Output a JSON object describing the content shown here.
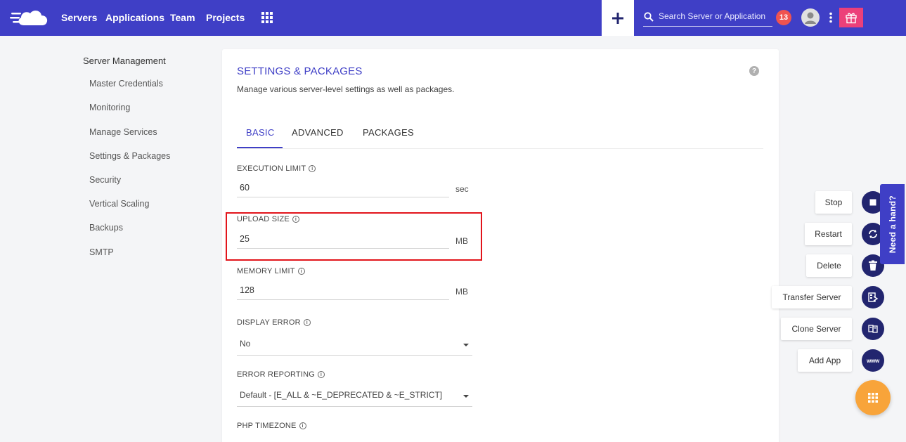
{
  "header": {
    "nav": [
      "Servers",
      "Applications",
      "Team",
      "Projects"
    ],
    "search_placeholder": "Search Server or Application",
    "notification_count": "13",
    "accent_color": "#3f3fc6"
  },
  "sidebar": {
    "title": "Server Management",
    "items": [
      "Master Credentials",
      "Monitoring",
      "Manage Services",
      "Settings & Packages",
      "Security",
      "Vertical Scaling",
      "Backups",
      "SMTP"
    ]
  },
  "card": {
    "title": "SETTINGS & PACKAGES",
    "subtitle": "Manage various server-level settings as well as packages.",
    "help": "?",
    "tabs": [
      "BASIC",
      "ADVANCED",
      "PACKAGES"
    ],
    "active_tab": "BASIC",
    "fields": {
      "execution_limit": {
        "label": "EXECUTION LIMIT",
        "value": "60",
        "unit": "sec"
      },
      "upload_size": {
        "label": "UPLOAD SIZE",
        "value": "25",
        "unit": "MB"
      },
      "memory_limit": {
        "label": "MEMORY LIMIT",
        "value": "128",
        "unit": "MB"
      },
      "display_error": {
        "label": "DISPLAY ERROR",
        "value": "No"
      },
      "error_reporting": {
        "label": "ERROR REPORTING",
        "value": "Default - [E_ALL & ~E_DEPRECATED & ~E_STRICT]"
      },
      "php_timezone": {
        "label": "PHP TIMEZONE"
      }
    }
  },
  "actions": {
    "stop": "Stop",
    "restart": "Restart",
    "delete": "Delete",
    "transfer": "Transfer Server",
    "clone": "Clone Server",
    "add_app": "Add App",
    "www": "www"
  },
  "need_hand": "Need a hand?"
}
